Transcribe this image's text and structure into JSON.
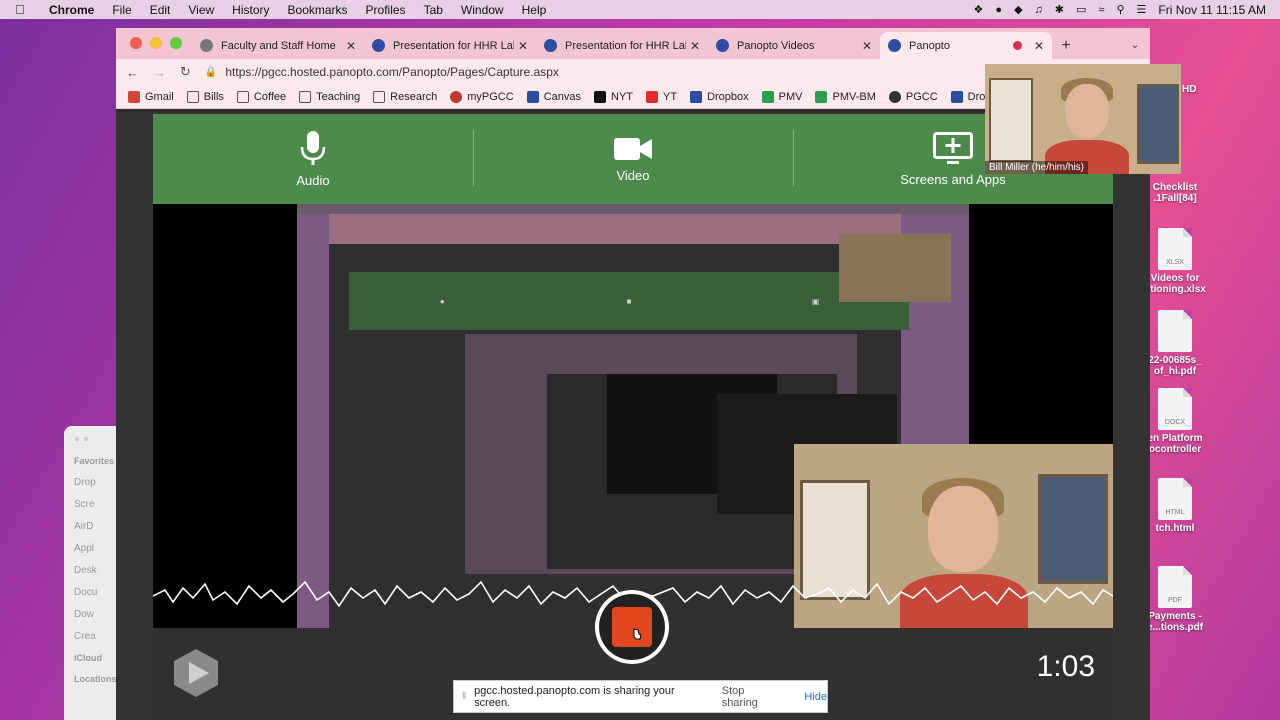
{
  "menubar": {
    "app": "Chrome",
    "menus": [
      "File",
      "Edit",
      "View",
      "History",
      "Bookmarks",
      "Profiles",
      "Tab",
      "Window",
      "Help"
    ],
    "clock": "Fri Nov 11  11:15 AM"
  },
  "tabs": [
    {
      "title": "Faculty and Staff Home"
    },
    {
      "title": "Presentation for HHR Lab"
    },
    {
      "title": "Presentation for HHR Lab"
    },
    {
      "title": "Panopto Videos"
    },
    {
      "title": "Panopto"
    }
  ],
  "address": {
    "url": "https://pgcc.hosted.panopto.com/Panopto/Pages/Capture.aspx"
  },
  "bookmarks": [
    {
      "label": "Gmail",
      "color": "#d44638"
    },
    {
      "label": "Bills",
      "color": "#555555"
    },
    {
      "label": "Coffee",
      "color": "#555555"
    },
    {
      "label": "Teaching",
      "color": "#555555"
    },
    {
      "label": "Research",
      "color": "#555555"
    },
    {
      "label": "myPGCC",
      "color": "#c0392b"
    },
    {
      "label": "Canvas",
      "color": "#2c4c9f"
    },
    {
      "label": "NYT",
      "color": "#111111"
    },
    {
      "label": "YT",
      "color": "#e52d27"
    },
    {
      "label": "Dropbox",
      "color": "#2c4c9f"
    },
    {
      "label": "PMV",
      "color": "#2e9d4e"
    },
    {
      "label": "PMV-BM",
      "color": "#2e9d4e"
    },
    {
      "label": "PGCC",
      "color": "#333333"
    },
    {
      "label": "Dropb",
      "color": "#2c4c9f"
    }
  ],
  "capture": {
    "audio_label": "Audio",
    "video_label": "Video",
    "screens_label": "Screens and Apps",
    "timer": "1:03"
  },
  "webcam": {
    "name": "Bill Miller (he/him/his)"
  },
  "share_bar": {
    "message": "pgcc.hosted.panopto.com is sharing your screen.",
    "stop": "Stop sharing",
    "hide": "Hide"
  },
  "desktop": {
    "items": [
      "Checklist .1Fall[84]",
      "Videos for ptioning.xlsx",
      "22-00685s_ of_hi.pdf",
      "en Platform ocontroller",
      "tch.html",
      "Payments - e...tions.pdf"
    ],
    "hd_label": "HD"
  },
  "finder": {
    "favorites": "Favorites",
    "items": [
      "Drop",
      "Scre",
      "AirD",
      "Appl",
      "Desk",
      "Docu",
      "Dow",
      "Crea"
    ],
    "icloud": "iCloud",
    "locations": "Locations"
  },
  "colors": {
    "accent_green": "#4d8b4d",
    "record_red": "#e3471f"
  }
}
